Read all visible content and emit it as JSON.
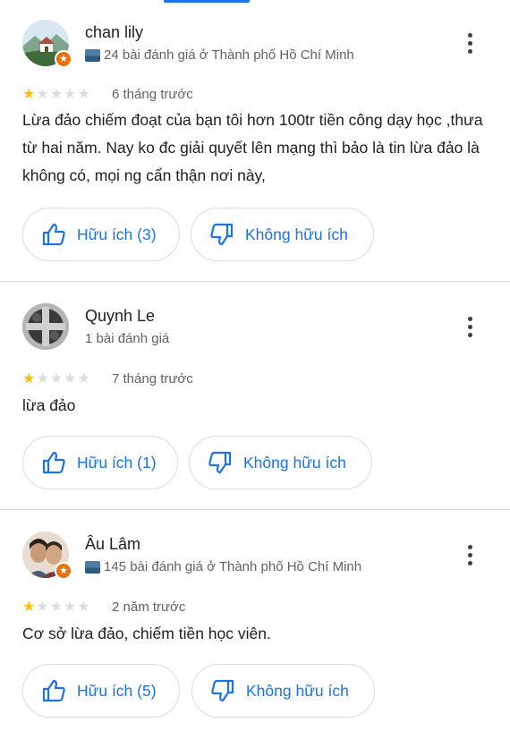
{
  "reviews": [
    {
      "name": "chan lily",
      "meta": "24 bài đánh giá ở Thành phố Hồ Chí Minh",
      "rating": 1,
      "time": "6 tháng trước",
      "text": "Lừa đảo chiếm đoạt của bạn tôi hơn 100tr tiền công dạy học ,thưa từ hai năm. Nay ko đc giải quyết lên mạng thì bảo là tin lừa đảo là không có, mọi ng cẩn thận nơi này,",
      "helpful_label": "Hữu ích (3)",
      "not_helpful_label": "Không hữu ích",
      "local_guide": true
    },
    {
      "name": "Quynh Le",
      "meta": "1 bài đánh giá",
      "rating": 1,
      "time": "7 tháng trước",
      "text": "lừa đảo",
      "helpful_label": "Hữu ích (1)",
      "not_helpful_label": "Không hữu ích",
      "local_guide": false
    },
    {
      "name": "Âu Lâm",
      "meta": "145 bài đánh giá ở Thành phố Hồ Chí Minh",
      "rating": 1,
      "time": "2 năm trước",
      "text": "Cơ sở lừa đảo, chiếm tiền học viên.",
      "helpful_label": "Hữu ích (5)",
      "not_helpful_label": "Không hữu ích",
      "local_guide": true
    }
  ],
  "colors": {
    "accent": "#1a73e8",
    "star": "#fbbc04",
    "badge": "#e8710a"
  }
}
